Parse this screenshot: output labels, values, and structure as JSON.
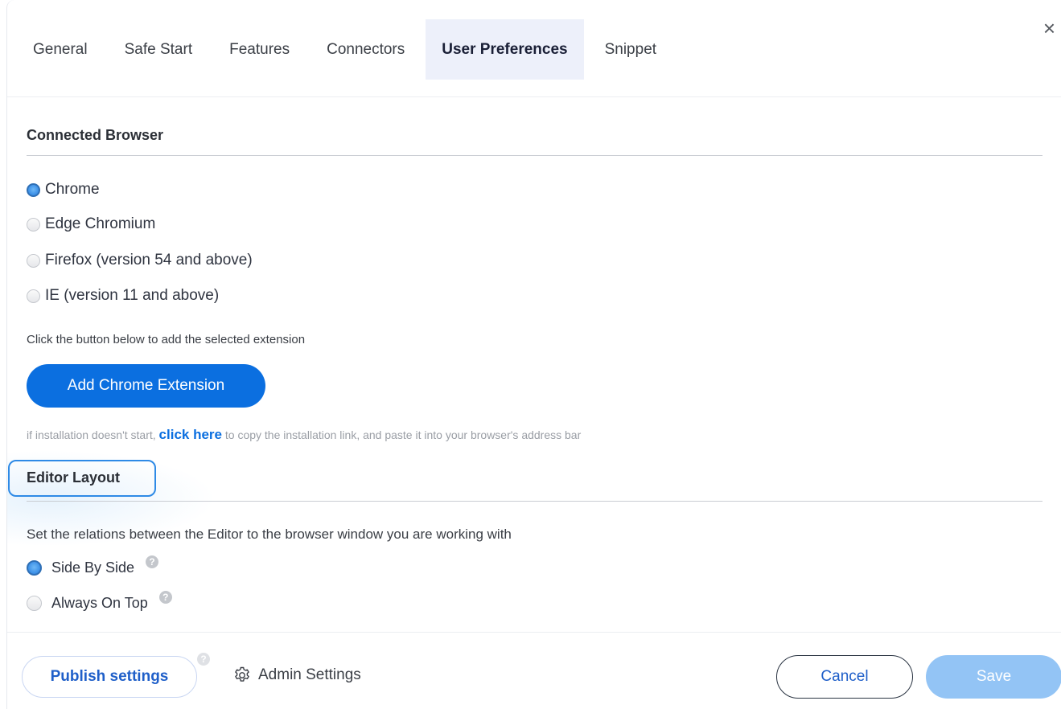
{
  "tabs": [
    {
      "label": "General",
      "active": false
    },
    {
      "label": "Safe Start",
      "active": false
    },
    {
      "label": "Features",
      "active": false
    },
    {
      "label": "Connectors",
      "active": false
    },
    {
      "label": "User Preferences",
      "active": true
    },
    {
      "label": "Snippet",
      "active": false
    }
  ],
  "close_icon": "×",
  "connected_browser": {
    "title": "Connected Browser",
    "options": [
      {
        "label": "Chrome",
        "checked": true
      },
      {
        "label": "Edge Chromium",
        "checked": false
      },
      {
        "label": "Firefox (version 54 and above)",
        "checked": false
      },
      {
        "label": "IE (version 11 and above)",
        "checked": false
      }
    ],
    "hint": "Click the button below to add the selected extension",
    "add_button": "Add Chrome Extension",
    "install_note_prefix": "if installation doesn't start,",
    "install_note_link": "click here",
    "install_note_suffix": "to copy the installation link, and paste it into your browser's address bar"
  },
  "editor_layout": {
    "title": "Editor Layout",
    "description": "Set the relations between the Editor to the browser window you are working with",
    "options": [
      {
        "label": "Side By Side",
        "checked": true
      },
      {
        "label": "Always On Top",
        "checked": false
      }
    ],
    "help_glyph": "?"
  },
  "footer": {
    "publish_label": "Publish settings",
    "admin_label": "Admin Settings",
    "cancel_label": "Cancel",
    "save_label": "Save"
  },
  "colors": {
    "accent": "#0b6fe0",
    "active_tab_bg": "#edf0fa",
    "save_disabled": "#93c4f5"
  }
}
